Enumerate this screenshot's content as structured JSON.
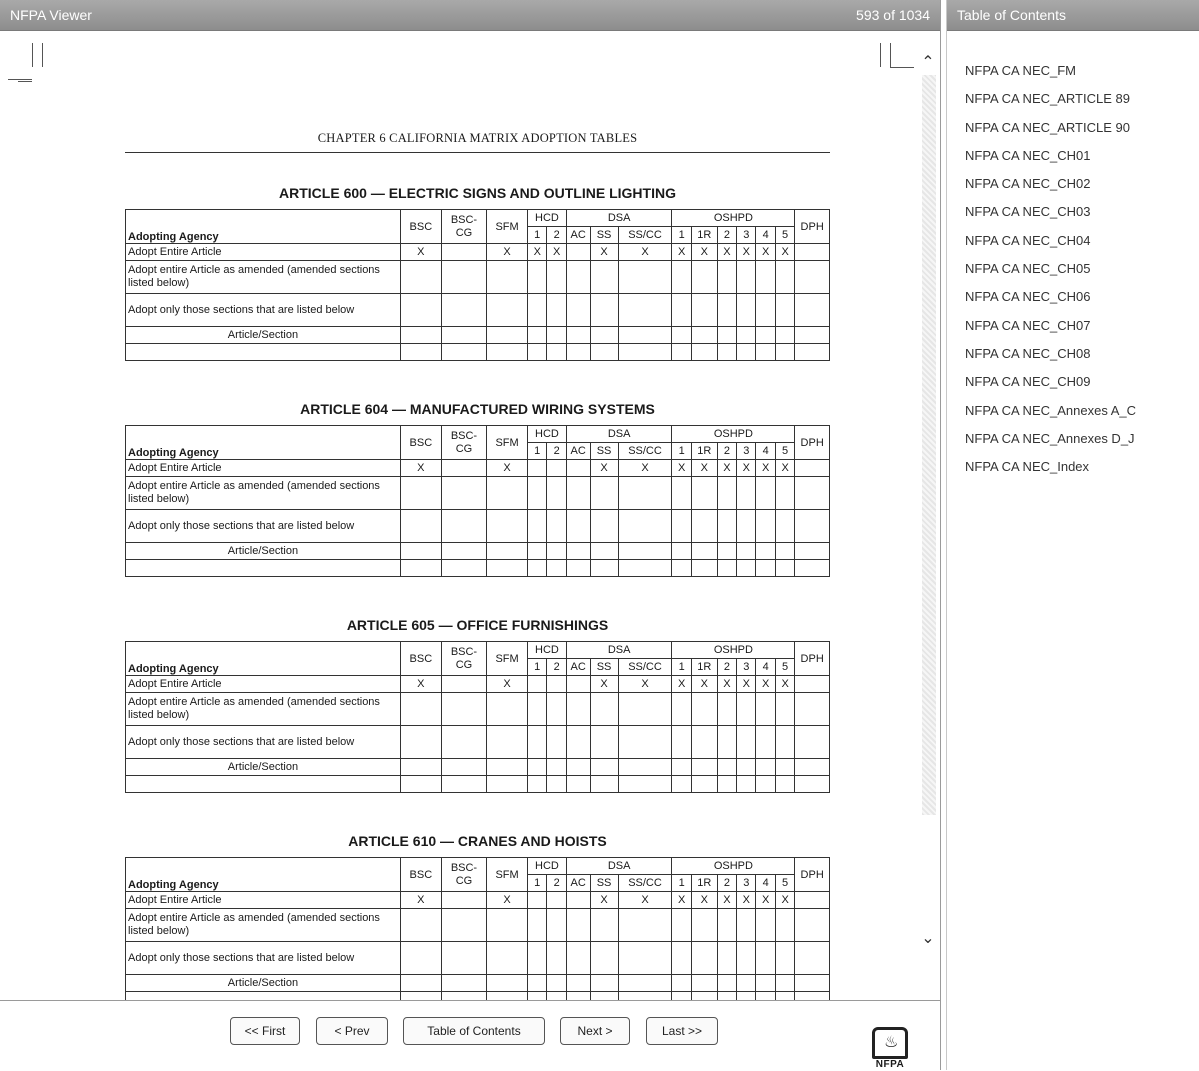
{
  "viewer": {
    "title": "NFPA Viewer",
    "page_counter": "593 of 1034"
  },
  "document": {
    "chapter_header": "CHAPTER 6 CALIFORNIA MATRIX ADOPTION TABLES",
    "matrix_header": {
      "adopting_agency": "Adopting Agency",
      "bsc": "BSC",
      "bsc_cg": "BSC-\nCG",
      "sfm": "SFM",
      "hcd": "HCD",
      "hcd_cols": [
        "1",
        "2"
      ],
      "dsa": "DSA",
      "dsa_cols": [
        "AC",
        "SS",
        "SS/CC"
      ],
      "oshpd": "OSHPD",
      "oshpd_cols": [
        "1",
        "1R",
        "2",
        "3",
        "4",
        "5"
      ],
      "dph": "DPH"
    },
    "row_labels": {
      "entire": "Adopt Entire Article",
      "amended": "Adopt entire Article as amended (amended sections listed below)",
      "sections": "Adopt only those sections that are listed below",
      "article_section": "Article/Section"
    },
    "mark": "X",
    "articles": [
      {
        "title": "ARTICLE 600 — ELECTRIC SIGNS AND OUTLINE LIGHTING",
        "entire_row": [
          "X",
          "",
          "X",
          "X",
          "X",
          "",
          "X",
          "X",
          "X",
          "X",
          "X",
          "X",
          "X",
          "X",
          ""
        ]
      },
      {
        "title": "ARTICLE 604 — MANUFACTURED WIRING SYSTEMS",
        "entire_row": [
          "X",
          "",
          "X",
          "",
          "",
          "",
          "X",
          "X",
          "X",
          "X",
          "X",
          "X",
          "X",
          "X",
          ""
        ]
      },
      {
        "title": "ARTICLE 605 — OFFICE FURNISHINGS",
        "entire_row": [
          "X",
          "",
          "X",
          "",
          "",
          "",
          "X",
          "X",
          "X",
          "X",
          "X",
          "X",
          "X",
          "X",
          ""
        ]
      },
      {
        "title": "ARTICLE 610 — CRANES AND HOISTS",
        "entire_row": [
          "X",
          "",
          "X",
          "",
          "",
          "",
          "X",
          "X",
          "X",
          "X",
          "X",
          "X",
          "X",
          "X",
          ""
        ]
      }
    ]
  },
  "nav": {
    "first": "<< First",
    "prev": "< Prev",
    "toc": "Table of Contents",
    "next": "Next >",
    "last": "Last >>",
    "logo_text": "NFPA"
  },
  "toc": {
    "title": "Table of Contents",
    "items": [
      "NFPA CA NEC_FM",
      "NFPA CA NEC_ARTICLE 89",
      "NFPA CA NEC_ARTICLE 90",
      "NFPA CA NEC_CH01",
      "NFPA CA NEC_CH02",
      "NFPA CA NEC_CH03",
      "NFPA CA NEC_CH04",
      "NFPA CA NEC_CH05",
      "NFPA CA NEC_CH06",
      "NFPA CA NEC_CH07",
      "NFPA CA NEC_CH08",
      "NFPA CA NEC_CH09",
      "NFPA CA NEC_Annexes A_C",
      "NFPA CA NEC_Annexes D_J",
      "NFPA CA NEC_Index"
    ]
  }
}
